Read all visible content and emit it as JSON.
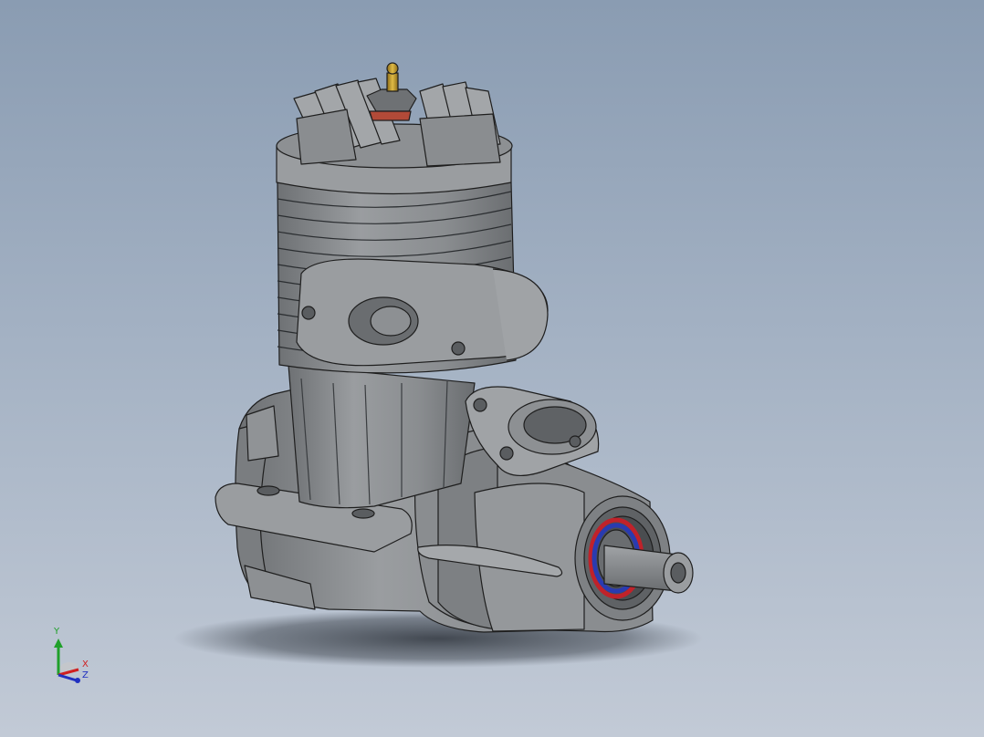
{
  "viewport": {
    "background_top": "#8a9cb2",
    "background_bottom": "#c2cad6"
  },
  "model": {
    "body_color": "#8a8d90",
    "edge_color": "#1e1e1e",
    "bearing_colors": [
      "#c0222a",
      "#2a3bb0"
    ],
    "glow_plug_color": "#b8932a"
  },
  "triad": {
    "y_label": "Y",
    "x_label": "X",
    "z_label": "Z",
    "y_color": "#1fa02a",
    "x_color": "#d02020",
    "z_color": "#2030c0"
  }
}
